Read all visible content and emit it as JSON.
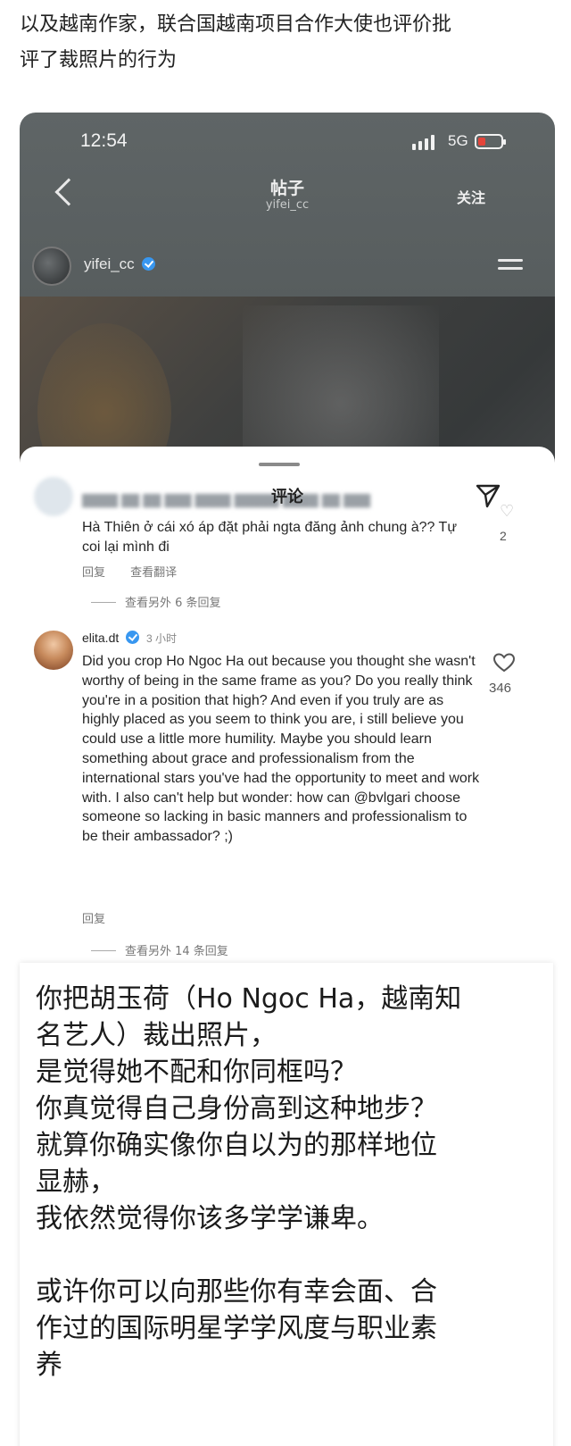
{
  "intro": {
    "line1": "以及越南作家，联合国越南项目合作大使也评价批",
    "line2": "评了裁照片的行为"
  },
  "phone": {
    "status": {
      "time": "12:54",
      "network": "5G"
    },
    "nav": {
      "title": "帖子",
      "subtitle": "yifei_cc",
      "follow": "关注"
    },
    "post": {
      "username": "yifei_cc"
    },
    "sheet": {
      "title": "评论",
      "comment1": {
        "text": "Hà Thiên ở cái xó áp đặt phải ngta đăng ảnh chung à?? Tự coi lại mình đi",
        "likes": "2",
        "reply": "回复",
        "translate": "查看翻译",
        "more_replies": "查看另外 6 条回复"
      },
      "comment2": {
        "username": "elita.dt",
        "time": "3 小时",
        "text": "Did you crop Ho Ngoc Ha out because you thought she wasn't worthy of being in the same frame as you? Do you really think you're in a position that high? And even if you truly are as highly placed as you seem to think you are, i still believe you could use a little more humility. Maybe you should learn something about grace and professionalism from the international stars you've had the opportunity to meet and work with. I also can't help but wonder: how can @bvlgari choose someone so lacking in basic manners and professionalism to be their ambassador? ;)",
        "likes": "346",
        "reply": "回复",
        "more_replies": "查看另外 14 条回复"
      }
    }
  },
  "translation": {
    "lines": [
      "你把胡玉荷（Ho Ngoc Ha，越南知",
      "名艺人）裁出照片，",
      "是觉得她不配和你同框吗？",
      "你真觉得自己身份高到这种地步？",
      "就算你确实像你自以为的那样地位",
      "显赫，",
      "我依然觉得你该多学学谦卑。",
      "",
      "或许你可以向那些你有幸会面、合",
      "作过的国际明星学学风度与职业素",
      "养"
    ]
  },
  "colors": {
    "verified": "#3897f0",
    "battery_low": "#e4443a"
  }
}
